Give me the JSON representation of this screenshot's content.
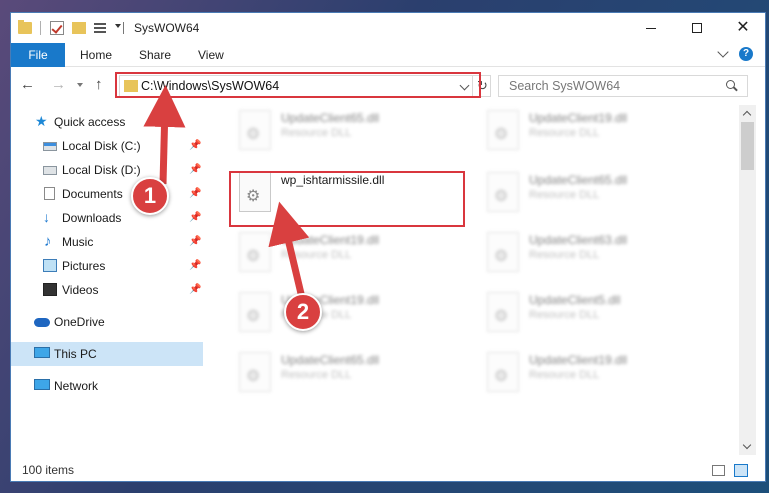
{
  "window": {
    "title": "SysWOW64",
    "controls": {
      "minimize": "minimize",
      "maximize": "maximize",
      "close": "✕"
    }
  },
  "ribbon": {
    "tabs": [
      {
        "label": "File"
      },
      {
        "label": "Home"
      },
      {
        "label": "Share"
      },
      {
        "label": "View"
      }
    ],
    "help": "?"
  },
  "navigation": {
    "back": "←",
    "forward": "→",
    "up": "↑",
    "address": "C:\\Windows\\SysWOW64",
    "refresh": "↻",
    "search_placeholder": "Search SysWOW64"
  },
  "sidebar": {
    "items": [
      {
        "label": "Quick access",
        "icon": "star-icon",
        "pinned": false
      },
      {
        "label": "Local Disk (C:)",
        "icon": "drive-icon",
        "pinned": true
      },
      {
        "label": "Local Disk (D:)",
        "icon": "drive-icon",
        "pinned": true
      },
      {
        "label": "Documents",
        "icon": "documents-icon",
        "pinned": true
      },
      {
        "label": "Downloads",
        "icon": "downloads-icon",
        "pinned": true
      },
      {
        "label": "Music",
        "icon": "music-icon",
        "pinned": true
      },
      {
        "label": "Pictures",
        "icon": "pictures-icon",
        "pinned": true
      },
      {
        "label": "Videos",
        "icon": "videos-icon",
        "pinned": true
      },
      {
        "label": "OneDrive",
        "icon": "onedrive-icon",
        "pinned": false
      },
      {
        "label": "This PC",
        "icon": "pc-icon",
        "pinned": false,
        "selected": true
      },
      {
        "label": "Network",
        "icon": "network-icon",
        "pinned": false
      }
    ],
    "pin_glyph": "📌"
  },
  "files": {
    "left_column": [
      {
        "name": "UpdateClient65.dll",
        "type": "Resource DLL"
      },
      {
        "name": "wp_ishtarmissile.dll",
        "type": ""
      },
      {
        "name": "UpdateClient19.dll",
        "type": "Resource DLL"
      },
      {
        "name": "UpdateClient19.dll",
        "type": "Resource DLL"
      },
      {
        "name": "UpdateClient65.dll",
        "type": "Resource DLL"
      }
    ],
    "right_column": [
      {
        "name": "UpdateClient19.dll",
        "type": "Resource DLL"
      },
      {
        "name": "UpdateClient65.dll",
        "type": "Resource DLL"
      },
      {
        "name": "UpdateClient63.dll",
        "type": "Resource DLL"
      },
      {
        "name": "UpdateClient5.dll",
        "type": "Resource DLL"
      },
      {
        "name": "UpdateClient19.dll",
        "type": "Resource DLL"
      }
    ]
  },
  "status": {
    "item_count": "100 items"
  },
  "annotations": {
    "markers": [
      "1",
      "2"
    ],
    "color": "#d94040"
  },
  "colors": {
    "accent": "#1979ca",
    "selection": "#cce4f7",
    "highlight": "#d9363e"
  }
}
